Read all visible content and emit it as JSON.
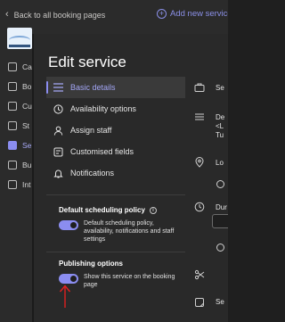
{
  "top_bar": {
    "back_label": "Back to all booking pages",
    "add_service_label": "Add new service"
  },
  "background_nav": {
    "items": [
      {
        "label": "Ca",
        "icon": "calendar-icon"
      },
      {
        "label": "Bo",
        "icon": "booking-page-icon"
      },
      {
        "label": "Cu",
        "icon": "customers-icon"
      },
      {
        "label": "St",
        "icon": "staff-icon"
      },
      {
        "label": "Se",
        "icon": "services-icon",
        "active": true
      },
      {
        "label": "Bu",
        "icon": "business-icon"
      },
      {
        "label": "Int",
        "icon": "integrations-icon"
      }
    ]
  },
  "panel": {
    "title": "Edit service",
    "menu": [
      {
        "label": "Basic details",
        "icon": "list-icon",
        "selected": true
      },
      {
        "label": "Availability options",
        "icon": "clock-icon"
      },
      {
        "label": "Assign staff",
        "icon": "person-icon"
      },
      {
        "label": "Customised fields",
        "icon": "form-icon"
      },
      {
        "label": "Notifications",
        "icon": "bell-icon"
      }
    ],
    "default_scheduling": {
      "title": "Default scheduling policy",
      "toggle_text": "Default scheduling policy, availability, notifications and staff settings",
      "toggle_on": true
    },
    "publishing": {
      "title": "Publishing options",
      "toggle_text": "Show this service on the booking page",
      "toggle_on": true
    }
  },
  "right_column": {
    "texts": [
      "Se",
      "De",
      "<L",
      "Tu",
      "Lo",
      "Dur",
      "Se"
    ]
  },
  "colors": {
    "accent": "#8b8df0",
    "panel_bg": "#292929",
    "app_bg": "#2b2b2b",
    "arrow": "#e02020"
  }
}
